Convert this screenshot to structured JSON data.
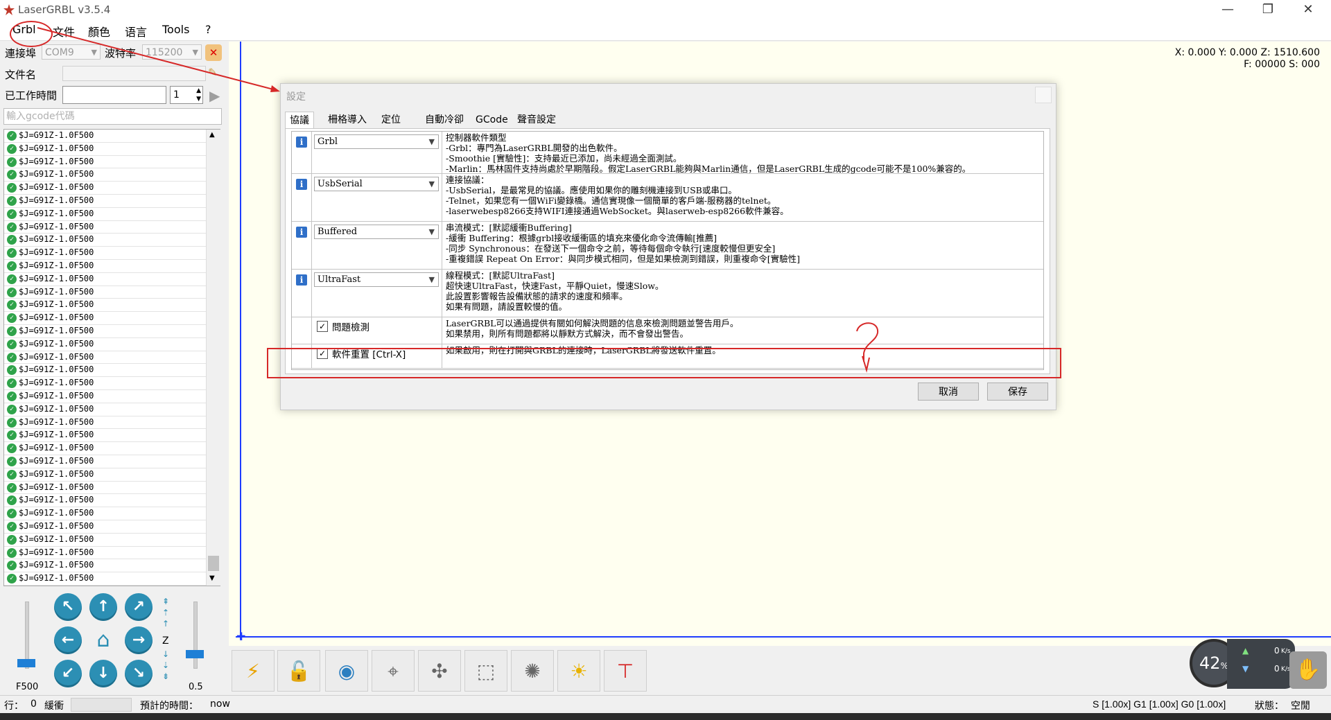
{
  "window": {
    "title": "LaserGRBL v3.5.4",
    "minimize": "—",
    "restore": "❐",
    "close": "✕"
  },
  "menu": {
    "items": [
      "Grbl",
      "文件",
      "顏色",
      "语言",
      "Tools",
      "?"
    ]
  },
  "connection": {
    "port_label": "連接埠",
    "port_value": "COM9",
    "baud_label": "波特率",
    "baud_value": "115200",
    "filename_label": "文件名",
    "filename_value": "",
    "worktime_label": "已工作時間",
    "worktime_value": "",
    "passes": "1",
    "gcode_placeholder": "輸入gcode代碼"
  },
  "command_log": {
    "rows": [
      "$J=G91Z-1.0F500",
      "$J=G91Z-1.0F500",
      "$J=G91Z-1.0F500",
      "$J=G91Z-1.0F500",
      "$J=G91Z-1.0F500",
      "$J=G91Z-1.0F500",
      "$J=G91Z-1.0F500",
      "$J=G91Z-1.0F500",
      "$J=G91Z-1.0F500",
      "$J=G91Z-1.0F500",
      "$J=G91Z-1.0F500",
      "$J=G91Z-1.0F500",
      "$J=G91Z-1.0F500",
      "$J=G91Z-1.0F500",
      "$J=G91Z-1.0F500",
      "$J=G91Z-1.0F500",
      "$J=G91Z-1.0F500",
      "$J=G91Z-1.0F500",
      "$J=G91Z-1.0F500",
      "$J=G91Z-1.0F500",
      "$J=G91Z-1.0F500",
      "$J=G91Z-1.0F500",
      "$J=G91Z-1.0F500",
      "$J=G91Z-1.0F500",
      "$J=G91Z-1.0F500",
      "$J=G91Z-1.0F500",
      "$J=G91Z-1.0F500",
      "$J=G91Z-1.0F500",
      "$J=G91Z-1.0F500",
      "$J=G91Z-1.0F500",
      "$J=G91Z-1.0F500",
      "$J=G91Z-1.0F500",
      "$J=G91Z-1.0F500",
      "$J=G91Z-1.0F500",
      "$J=G91Z-1.0F500"
    ]
  },
  "jog": {
    "speed_label": "F500",
    "step_label": "0.5",
    "z_label": "Z"
  },
  "position": {
    "line1": "X: 0.000 Y: 0.000 Z: 1510.600",
    "line2": "F: 00000 S: 000"
  },
  "dialog": {
    "title": "設定",
    "tabs": [
      "協議",
      "柵格導入",
      "定位",
      "自動冷卻",
      "GCode",
      "聲音設定"
    ],
    "rows": [
      {
        "value": "Grbl",
        "desc": "控制器軟件類型\n-Grbl：專門為LaserGRBL開發的出色軟件。\n-Smoothie [實驗性]：支持最近已添加，尚未經過全面測試。\n-Marlin：馬林固件支持尚處於早期階段。假定LaserGRBL能夠與Marlin通信，但是LaserGRBL生成的gcode可能不是100%兼容的。"
      },
      {
        "value": "UsbSerial",
        "desc": "連接協議：\n-UsbSerial，是最常見的協議。應使用如果你的雕刻機連接到USB或串口。\n-Telnet，如果您有一個WiFi變錄橋。通信實現像一個簡單的客戶端-服務器的telnet。\n-laserwebesp8266支持WIFI連接通過WebSocket。與laserweb-esp8266軟件兼容。"
      },
      {
        "value": "Buffered",
        "desc": "串流模式：[默認緩衝Buffering]\n-緩衝 Buffering：根據grbl接收緩衝區的填充來優化命令流傳輸[推薦]\n-同步 Synchronous：在發送下一個命令之前，等待每個命令執行[速度較慢但更安全]\n-重複錯誤 Repeat On Error：與同步模式相同，但是如果檢測到錯誤，則重複命令[實驗性]"
      },
      {
        "value": "UltraFast",
        "desc": "線程模式：[默認UltraFast]\n超快速UltraFast，快速Fast，平靜Quiet，慢速Slow。\n此設置影響報告設備狀態的請求的速度和頻率。\n如果有問題，請設置較慢的值。"
      }
    ],
    "checks": [
      {
        "label": "問題檢測",
        "checked": "✓",
        "desc": "LaserGRBL可以通過提供有關如何解決問題的信息來檢測問題並警告用戶。\n如果禁用，則所有問題都將以靜默方式解決，而不會發出警告。"
      },
      {
        "label": "軟件重置 [Ctrl-X]",
        "checked": "✓",
        "desc": "如果啟用，則在打開與GRBL的連接時，LaserGRBL將發送軟件重置。"
      }
    ],
    "cancel": "取消",
    "save": "保存"
  },
  "gauge": {
    "percent": "42",
    "percent_sign": "%",
    "up_speed": "0",
    "down_speed": "0",
    "unit": "K/s"
  },
  "status": {
    "line_label": "行：",
    "line_value": "0",
    "buffer_label": "緩衝",
    "eta_label": "預計的時間：",
    "eta_value": "now",
    "overrides": "S [1.00x] G1 [1.00x] G0 [1.00x]",
    "state_label": "狀態：",
    "state_value": "空閒"
  },
  "colors": {
    "annotation": "#d62828",
    "canvas": "#fffff0",
    "accent": "#1e7fd6"
  }
}
